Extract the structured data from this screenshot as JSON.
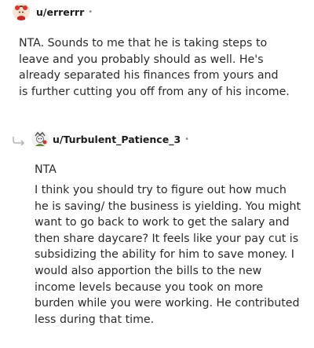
{
  "comment": {
    "username": "u/errerrr",
    "dot": "•",
    "body": "NTA. Sounds to me that he is taking steps to leave and you probably should as well. He's already separated his finances from yours and is further cutting you off from any of his income."
  },
  "reply": {
    "username": "u/Turbulent_Patience_3",
    "dot": "•",
    "line1": "NTA",
    "body": "I think you should try to figure out how much he is saving/ the business is yielding. You might want to go back to work to get the salary and then share daycare? It feels like your pay cut is subsidizing the ability for him to save money. I would also apportion the bills to the new income levels because you took on more burden while you were working. He contributed less during that time."
  },
  "icons": {
    "comment_avatar": "user-avatar-icon",
    "reply_avatar": "user-avatar-icon",
    "reply_arrow": "reply-arrow-icon"
  }
}
